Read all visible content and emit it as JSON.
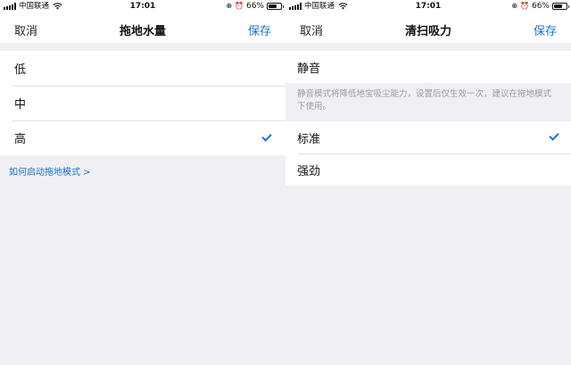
{
  "status_bar": {
    "carrier": "中国联通",
    "time": "17:01",
    "battery_percent": "66%",
    "battery_level": 0.66,
    "icons": [
      "signal-icon",
      "wifi-icon",
      "rotation-lock-icon",
      "alarm-icon",
      "battery-icon"
    ]
  },
  "left_screen": {
    "nav": {
      "cancel": "取消",
      "title": "拖地水量",
      "save": "保存"
    },
    "options": [
      {
        "label": "低",
        "selected": false
      },
      {
        "label": "中",
        "selected": false
      },
      {
        "label": "高",
        "selected": true
      }
    ],
    "help_link": "如何启动拖地模式 >"
  },
  "right_screen": {
    "nav": {
      "cancel": "取消",
      "title": "清扫吸力",
      "save": "保存"
    },
    "quiet_option": {
      "label": "静音",
      "selected": false
    },
    "quiet_hint": "静音模式将降低地宝吸尘能力，设置后仅生效一次，建议在拖地模式下使用。",
    "options": [
      {
        "label": "标准",
        "selected": true
      },
      {
        "label": "强劲",
        "selected": false
      }
    ]
  },
  "colors": {
    "accent": "#1a73c8",
    "background": "#efeff4",
    "hint_text": "#9a9aa0"
  }
}
